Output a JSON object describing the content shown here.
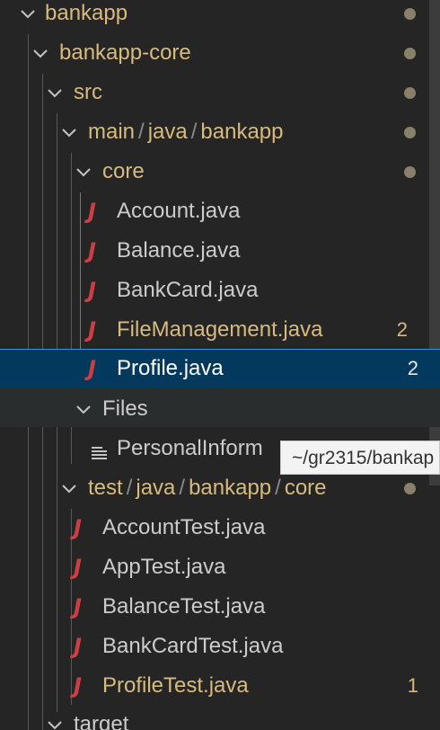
{
  "explorer": {
    "bankapp": {
      "label": "bankapp"
    },
    "bankapp_core": {
      "label": "bankapp-core"
    },
    "src": {
      "label": "src"
    },
    "main_path": {
      "parts": [
        "main",
        "java",
        "bankapp"
      ],
      "sep": "/"
    },
    "core": {
      "label": "core"
    },
    "account": {
      "label": "Account.java"
    },
    "balance": {
      "label": "Balance.java"
    },
    "bankcard": {
      "label": "BankCard.java"
    },
    "filemanagement": {
      "label": "FileManagement.java",
      "badge": "2"
    },
    "profile": {
      "label": "Profile.java",
      "badge": "2"
    },
    "files": {
      "label": "Files"
    },
    "personal": {
      "label": "PersonalInform"
    },
    "test_path": {
      "parts": [
        "test",
        "java",
        "bankapp",
        "core"
      ],
      "sep": "/"
    },
    "accounttest": {
      "label": "AccountTest.java"
    },
    "apptest": {
      "label": "AppTest.java"
    },
    "balancetest": {
      "label": "BalanceTest.java"
    },
    "bankcardtest": {
      "label": "BankCardTest.java"
    },
    "profiletest": {
      "label": "ProfileTest.java",
      "badge": "1"
    },
    "target": {
      "label": "target"
    }
  },
  "tooltip": {
    "text": "~/gr2315/bankap"
  },
  "icons": {
    "java": "java-file-icon",
    "text": "text-file-icon",
    "chevron": "chevron-down-icon"
  },
  "colors": {
    "modified": "#d7ba7d",
    "java_icon": "#cc3e44",
    "selection": "#04395e",
    "focus_border": "#3a8ee6"
  }
}
